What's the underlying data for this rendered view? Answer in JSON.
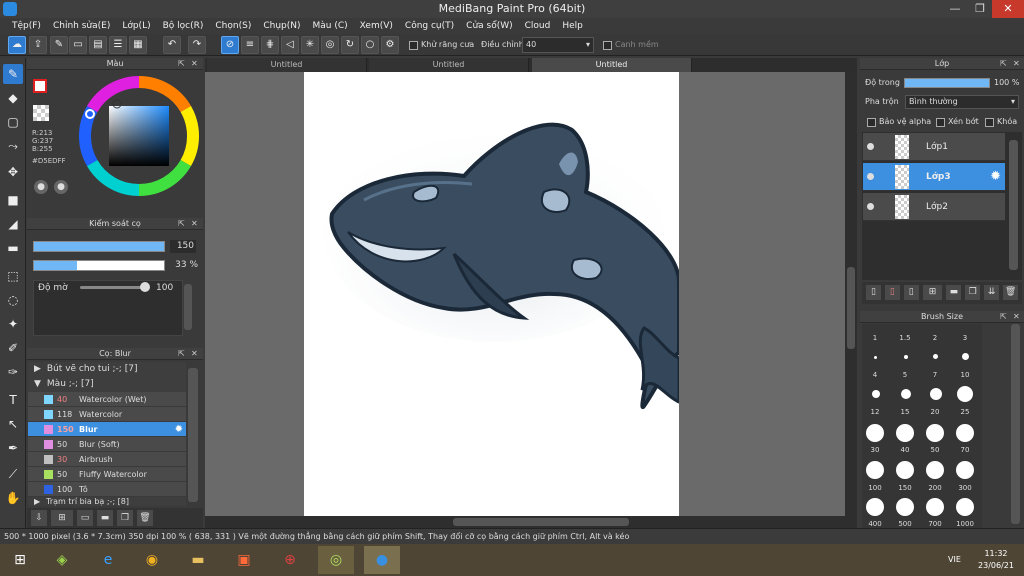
{
  "window": {
    "title": "MediBang Paint Pro (64bit)",
    "min": "—",
    "restore": "❐",
    "close": "✕"
  },
  "menu": [
    "Tệp(F)",
    "Chỉnh sửa(E)",
    "Lớp(L)",
    "Bộ lọc(R)",
    "Chọn(S)",
    "Chụp(N)",
    "Màu (C)",
    "Xem(V)",
    "Công cụ(T)",
    "Cửa sổ(W)",
    "Cloud",
    "Help"
  ],
  "toolbar": {
    "antialias_label": "Khử răng cưa",
    "smooth_label": "Điều chỉnh",
    "smooth_value": "40",
    "snap_label": "Canh mềm"
  },
  "tabs": [
    "Untitled",
    "Untitled",
    "Untitled"
  ],
  "color_panel": {
    "title": "Màu",
    "r": "R:213",
    "g": "G:237",
    "b": "B:255",
    "hex": "#D5EDFF"
  },
  "brush_control": {
    "title": "Kiểm soát cọ",
    "size": "150",
    "opacity": "33 %",
    "density_label": "Độ mờ",
    "density_value": "100"
  },
  "brush_panel": {
    "title": "Cọ: Blur",
    "groups": [
      {
        "label": "Bút vẽ cho tui ;-; [7]",
        "arrow": "▶"
      },
      {
        "label": "Màu ;-; [7]",
        "arrow": "▼"
      }
    ],
    "items": [
      {
        "size": "40",
        "name": "Watercolor (Wet)",
        "color": "#7fd6ff"
      },
      {
        "size": "118",
        "name": "Watercolor",
        "color": "#7fd6ff"
      },
      {
        "size": "150",
        "name": "Blur",
        "color": "#e08fe0"
      },
      {
        "size": "50",
        "name": "Blur (Soft)",
        "color": "#e08fe0"
      },
      {
        "size": "30",
        "name": "Airbrush",
        "color": "#c0c0c0"
      },
      {
        "size": "50",
        "name": "Fluffy Watercolor",
        "color": "#a8e060"
      },
      {
        "size": "100",
        "name": "Tô",
        "color": "#2f62e0"
      }
    ],
    "last_group": "Trạm trí bia bạ ;-; [8]"
  },
  "layers_panel": {
    "title": "Lớp",
    "opacity_label": "Độ trong",
    "opacity_value": "100 %",
    "blend_label": "Pha trộn",
    "blend_value": "Bình thường",
    "protect_alpha": "Bảo vệ alpha",
    "clipping": "Xén bớt",
    "lock": "Khóa",
    "layers": [
      {
        "name": "Lớp1"
      },
      {
        "name": "Lớp3"
      },
      {
        "name": "Lớp2"
      }
    ]
  },
  "brush_size": {
    "title": "Brush Size",
    "rows": [
      [
        "1",
        "1.5",
        "2",
        "3"
      ],
      [
        "4",
        "5",
        "7",
        "10"
      ],
      [
        "12",
        "15",
        "20",
        "25"
      ],
      [
        "30",
        "40",
        "50",
        "70"
      ],
      [
        "100",
        "150",
        "200",
        "300"
      ],
      [
        "400",
        "500",
        "700",
        "1000"
      ]
    ]
  },
  "status": {
    "text": "500 * 1000 pixel   (3.6 * 7.3cm)   350 dpi   100 %   ( 638, 331 )   Vẽ một đường thẳng bằng cách giữ phím Shift, Thay đổi cỡ cọ bằng cách giữ phím Ctrl, Alt và kéo"
  },
  "taskbar": {
    "lang": "VIE",
    "time": "11:32",
    "date": "23/06/21"
  }
}
